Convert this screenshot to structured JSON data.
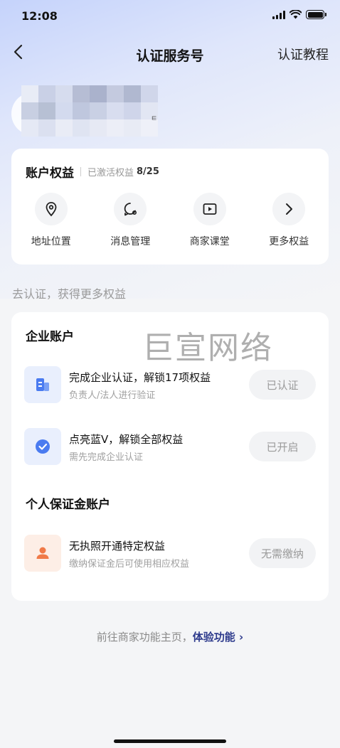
{
  "status_bar": {
    "time": "12:08"
  },
  "nav": {
    "title": "认证服务号",
    "right_label": "认证教程",
    "back_icon": "chevron-left-icon"
  },
  "profile": {
    "mark": "ㅌ"
  },
  "rights": {
    "title": "账户权益",
    "activated_label": "已激活权益",
    "count": "8/25",
    "items": [
      {
        "label": "地址位置",
        "icon": "location-pin-icon"
      },
      {
        "label": "消息管理",
        "icon": "message-bubble-icon"
      },
      {
        "label": "商家课堂",
        "icon": "video-play-icon"
      },
      {
        "label": "更多权益",
        "icon": "chevron-right-icon"
      }
    ]
  },
  "section_hint": "去认证，获得更多权益",
  "enterprise": {
    "title": "企业账户",
    "rows": [
      {
        "title": "完成企业认证，解锁17项权益",
        "subtitle": "负责人/法人进行验证",
        "button": "已认证",
        "icon": "building-icon",
        "color": "#4a7bf0"
      },
      {
        "title": "点亮蓝V，解锁全部权益",
        "subtitle": "需先完成企业认证",
        "button": "已开启",
        "icon": "blue-v-check-icon",
        "color": "#4a7bf0"
      }
    ]
  },
  "personal": {
    "title": "个人保证金账户",
    "rows": [
      {
        "title": "无执照开通特定权益",
        "subtitle": "缴纳保证金后可使用相应权益",
        "button": "无需缴纳",
        "icon": "person-icon",
        "color": "#f07a48"
      }
    ]
  },
  "watermark": "巨宣网络",
  "footer": {
    "text": "前往商家功能主页，",
    "link": "体验功能 ›"
  }
}
